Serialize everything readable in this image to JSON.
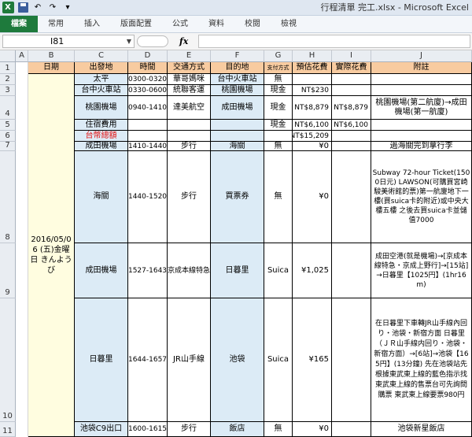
{
  "window": {
    "title": "行程清單 完工.xlsx - Microsoft Excel"
  },
  "ribbon": {
    "tabs": [
      "檔案",
      "常用",
      "插入",
      "版面配置",
      "公式",
      "資料",
      "校閱",
      "檢視"
    ]
  },
  "formula_bar": {
    "name_box": "I81",
    "fx_label": "fx",
    "content": ""
  },
  "columns": [
    "A",
    "B",
    "C",
    "D",
    "E",
    "F",
    "G",
    "H",
    "I",
    "J"
  ],
  "rows": [
    "1",
    "2",
    "3",
    "4",
    "5",
    "6",
    "7",
    "8",
    "9",
    "10",
    "11"
  ],
  "table": {
    "headers": {
      "date": "日期",
      "from": "出發地",
      "time": "時間",
      "transport": "交通方式",
      "destination": "目的地",
      "payment": "支付方式",
      "estimated": "預估花費",
      "actual": "實際花費",
      "notes": "附註"
    },
    "date_value": "2016/05/06 (五)金曜日 きんようび",
    "r2": {
      "from": "太平",
      "time": "0300-0320",
      "transport": "華哥媽咪",
      "destination": "台中火車站",
      "payment": "無"
    },
    "r3": {
      "from": "台中火車站",
      "time": "0330-0600",
      "transport": "統聯客運",
      "destination": "桃園機場",
      "payment": "現金",
      "estimated": "NT$230"
    },
    "r4": {
      "from": "桃園機場",
      "time": "0940-1410",
      "transport": "達美航空",
      "destination": "成田機場",
      "payment": "現金",
      "estimated": "NT$8,879",
      "actual": "NT$8,879",
      "notes": "桃園機場(第二航廈)→成田機場(第一航廈)"
    },
    "r5": {
      "from": "住宿費用",
      "payment": "現金",
      "estimated": "NT$6,100",
      "actual": "NT$6,100"
    },
    "r6": {
      "from": "台幣總額",
      "estimated": "NT$15,209"
    },
    "r7": {
      "from": "成田機場",
      "time": "1410-1440",
      "transport": "步行",
      "destination": "海關",
      "payment": "無",
      "estimated": "¥0",
      "notes": "過海關完到拿行李"
    },
    "r8": {
      "from": "海關",
      "time": "1440-1520",
      "transport": "步行",
      "destination": "買票券",
      "payment": "無",
      "estimated": "¥0",
      "notes": "Subway 72-hour Ticket(1500日元) LAWSON(可購買宮崎駿美術館的票)第一航廈地下一樓(買suica卡的附近)或中央大樓五樓 之後去買suica卡並儲值7000"
    },
    "r9": {
      "from": "成田機場",
      "time": "1527-1643",
      "transport": "京成本線特急",
      "destination": "日暮里",
      "payment": "Suica",
      "estimated": "¥1,025",
      "notes": "成田空港(就是機場)→[京成本線特急・京成上野行]→[15站]→日暮里【1025円】(1hr16m)"
    },
    "r10": {
      "from": "日暮里",
      "time": "1644-1657",
      "transport": "JR山手線",
      "destination": "池袋",
      "payment": "Suica",
      "estimated": "¥165",
      "notes": "在日暮里下車轉JR山手線內回り・池袋・新宿方面 日暮里 （ＪＲ山手線内回り・池袋・新宿方面）→[6站]→池袋【165円】(13分鐘) 先在池袋站先根據東武東上線的藍色指示找東武東上線的售票台可先詢問購票 東武東上線要票980円"
    },
    "r11": {
      "from": "池袋C9出口",
      "time": "1600-1615",
      "transport": "步行",
      "destination": "飯店",
      "payment": "無",
      "estimated": "¥0",
      "notes": "池袋新星飯店"
    }
  }
}
